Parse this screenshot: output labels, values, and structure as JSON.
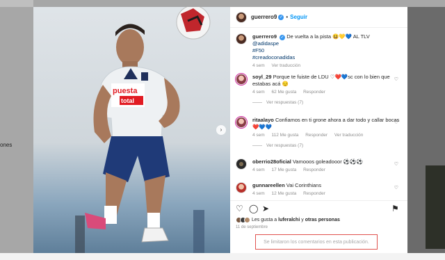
{
  "background": {
    "left_text": "ones"
  },
  "post": {
    "author": "guerrero9",
    "follow_label": "Seguir",
    "caption": {
      "text": "De vuelta a la pista 😆💛💙 AL TLV",
      "mention": "@adidaspe",
      "tag1": "#F50",
      "tag2": "#creadoconadidas",
      "time": "4 sem",
      "translate": "Ver traducción"
    },
    "comments": [
      {
        "user": "soyl_29",
        "text": "Porque te fuiste de LDU ♡❤️💙sc con lo bien que estabas acá 😔",
        "time": "4 sem",
        "likes": "62 Me gusta",
        "reply": "Responder",
        "view_replies": "Ver respuestas (7)"
      },
      {
        "user": "ritaalayo",
        "text": "Confiamos en ti grone ahora a dar todo y callar bocas ❤️💙💙",
        "time": "4 sem",
        "likes": "112 Me gusta",
        "reply": "Responder",
        "translate": "Ver traducción",
        "view_replies": "Ver respuestas (7)"
      },
      {
        "user": "oberrio28oficial",
        "text": "Vamooos goleadooor ⚽⚽⚽",
        "time": "4 sem",
        "likes": "17 Me gusta",
        "reply": "Responder"
      },
      {
        "user": "gunnareellen",
        "text": "Vai Corinthians",
        "time": "4 sem",
        "likes": "12 Me gusta",
        "reply": "Responder"
      }
    ],
    "likes_prefix": "Les gusta a",
    "likes_user": "luferalchi",
    "likes_and": "y",
    "likes_others": "otras personas",
    "date": "11 de septiembre",
    "comments_disabled": "Se limitaron los comentarios en esta publicación."
  },
  "photo": {
    "jersey_text1": "puesta",
    "jersey_text2": "total"
  },
  "colors": {
    "accent": "#0095f6",
    "highlight_box": "#e0514d"
  }
}
